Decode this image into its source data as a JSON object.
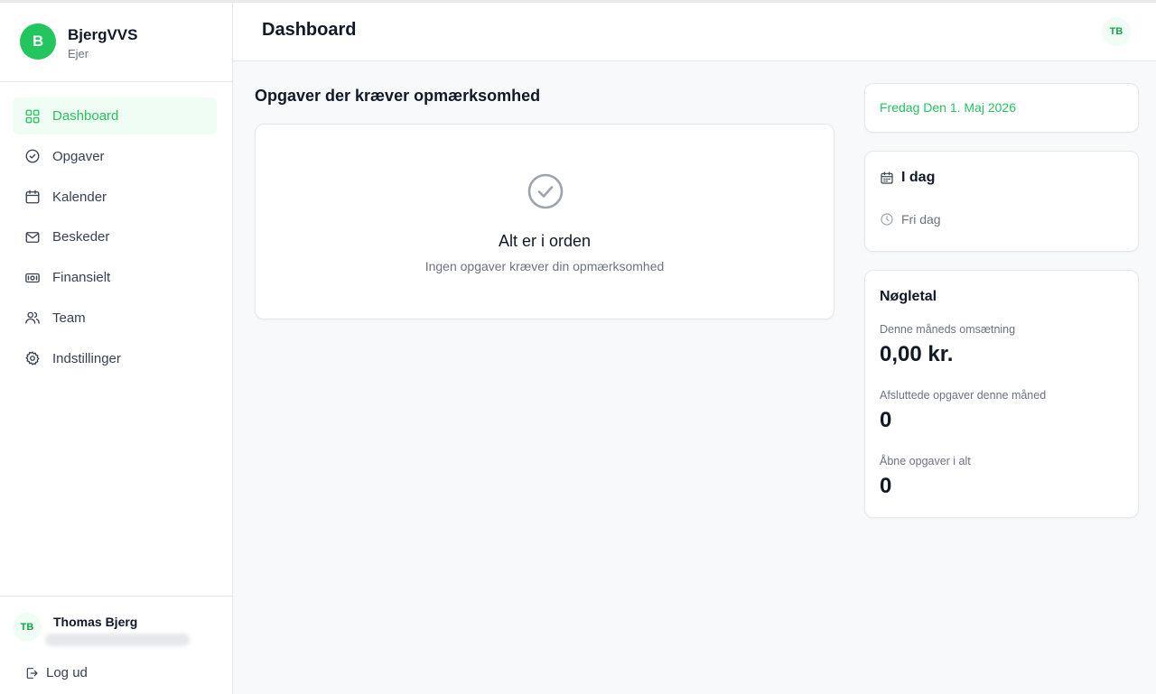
{
  "colors": {
    "accent": "#22c55e",
    "accent_bg": "#f0fdf4",
    "text": "#111827",
    "muted": "#6b7280",
    "border": "#e5e7eb"
  },
  "brand": {
    "avatar_letter": "B",
    "name": "BjergVVS",
    "role": "Ejer"
  },
  "nav": [
    {
      "label": "Dashboard",
      "icon": "grid-icon",
      "active": true
    },
    {
      "label": "Opgaver",
      "icon": "check-circle-icon"
    },
    {
      "label": "Kalender",
      "icon": "calendar-icon"
    },
    {
      "label": "Beskeder",
      "icon": "mail-icon"
    },
    {
      "label": "Finansielt",
      "icon": "banknote-icon"
    },
    {
      "label": "Team",
      "icon": "users-icon"
    },
    {
      "label": "Indstillinger",
      "icon": "gear-icon"
    }
  ],
  "user": {
    "initials": "TB",
    "name": "Thomas Bjerg",
    "logout_label": "Log ud"
  },
  "header": {
    "title": "Dashboard",
    "avatar_initials": "TB"
  },
  "attention": {
    "section_title": "Opgaver der kræver opmærksomhed",
    "empty_title": "Alt er i orden",
    "empty_subtitle": "Ingen opgaver kræver din opmærksomhed"
  },
  "date_card": {
    "text": "Fredag Den 1. Maj 2026"
  },
  "today": {
    "title": "I dag",
    "status": "Fri dag"
  },
  "kpi": {
    "title": "Nøgletal",
    "revenue_label": "Denne måneds omsætning",
    "revenue_value": "0,00 kr.",
    "completed_label": "Afsluttede opgaver denne måned",
    "completed_value": "0",
    "open_label": "Åbne opgaver i alt",
    "open_value": "0"
  }
}
